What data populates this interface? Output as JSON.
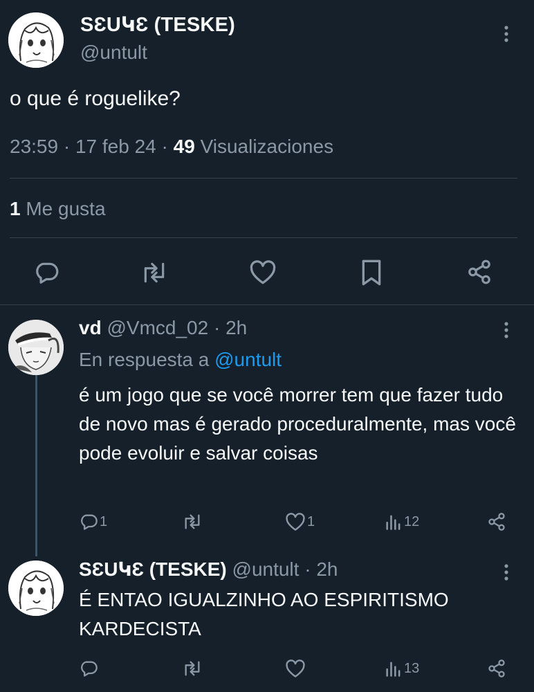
{
  "main_tweet": {
    "author_name": "SƐUԿƐ (TESKE)",
    "handle": "@untult",
    "text": "o que é roguelike?",
    "time": "23:59",
    "date": "17 feb 24",
    "views_count": "49",
    "views_label": "Visualizaciones",
    "likes_count": "1",
    "likes_label": "Me gusta",
    "actions": [
      "reply-icon",
      "retweet-icon",
      "like-icon",
      "bookmark-icon",
      "share-icon"
    ]
  },
  "replies": [
    {
      "author_name": "vd",
      "handle": "@Vmcd_02",
      "time": "2h",
      "replying_to_label": "En respuesta a",
      "replying_to_handle": "@untult",
      "text": "é um jogo que se você morrer tem que fazer tudo de novo mas é gerado proceduralmente, mas você pode evoluir e salvar coisas",
      "reply_count": "1",
      "retweet_count": "",
      "like_count": "1",
      "view_count": "12"
    },
    {
      "author_name": "SƐUԿƐ (TESKE)",
      "handle": "@untult",
      "time": "2h",
      "text": "É ENTAO IGUALZINHO AO ESPIRITISMO KARDECISTA",
      "reply_count": "",
      "retweet_count": "",
      "like_count": "",
      "view_count": "13"
    }
  ],
  "colors": {
    "background": "#15202b",
    "text": "#f7f9f9",
    "muted": "#8b98a5",
    "link": "#1d9bf0",
    "divider": "#38444d"
  }
}
